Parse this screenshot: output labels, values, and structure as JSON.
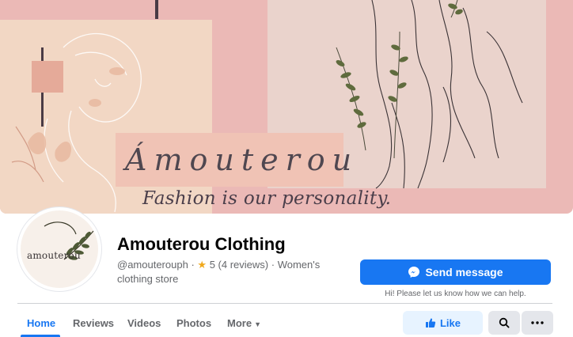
{
  "cover": {
    "brand": "Ámouterou",
    "tagline": "Fashion is our personality."
  },
  "profile": {
    "avatar_text": "amouterou",
    "name": "Amouterou Clothing",
    "handle": "@amouterouph",
    "separator": "·",
    "rating": "5 (4 reviews)",
    "category": "Women's clothing store"
  },
  "actions": {
    "send_message": "Send message",
    "send_note": "Hi! Please let us know how we can help.",
    "like": "Like"
  },
  "tabs": [
    {
      "label": "Home"
    },
    {
      "label": "Reviews"
    },
    {
      "label": "Videos"
    },
    {
      "label": "Photos"
    },
    {
      "label": "More"
    }
  ],
  "colors": {
    "accent": "#1877f2",
    "cover_pink": "#ebb9b6",
    "cover_peach": "#f2d7c4"
  },
  "icons": [
    "messenger-icon",
    "star-icon",
    "thumbs-up-icon",
    "search-icon",
    "more-dots-icon",
    "caret-down-icon"
  ]
}
